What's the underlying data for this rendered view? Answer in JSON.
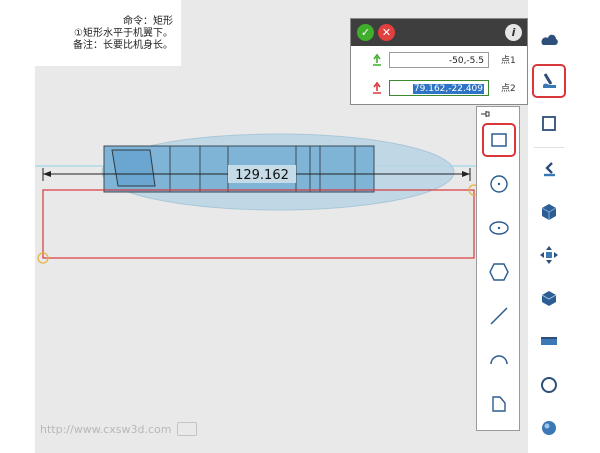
{
  "note": {
    "line1": "命令：矩形",
    "line2": "①矩形水平于机翼下。",
    "line3": "备注：长要比机身长。"
  },
  "dimension": {
    "value": "129.162"
  },
  "watermark": {
    "text": "http://www.cxsw3d.com"
  },
  "dialog": {
    "point1_label": "点1",
    "point1_value": "-50,-5.5",
    "point2_label": "点2",
    "point2_value": "79.162,-22.409"
  },
  "shape_tools": [
    {
      "icon": "rectangle-icon",
      "selected": true
    },
    {
      "icon": "circle-icon",
      "selected": false
    },
    {
      "icon": "ellipse-icon",
      "selected": false
    },
    {
      "icon": "hexagon-icon",
      "selected": false
    },
    {
      "icon": "line-icon",
      "selected": false
    },
    {
      "icon": "arc-icon",
      "selected": false
    },
    {
      "icon": "polyline-icon",
      "selected": false
    }
  ],
  "toolbar_tools": [
    {
      "icon": "cloud-shape-icon",
      "selected": false
    },
    {
      "icon": "sketch-pen-icon",
      "selected": true
    },
    {
      "icon": "square-icon",
      "selected": false
    },
    {
      "icon": "wrench-icon",
      "selected": false
    },
    {
      "icon": "cube-icon",
      "selected": false
    },
    {
      "icon": "move-arrows-icon",
      "selected": false
    },
    {
      "icon": "box-edit-icon",
      "selected": false
    },
    {
      "icon": "panel-icon",
      "selected": false
    },
    {
      "icon": "circle-outline-icon",
      "selected": false
    },
    {
      "icon": "sphere-icon",
      "selected": false
    }
  ],
  "colors": {
    "accent_red": "#d9373a",
    "ok_green": "#3fae2a",
    "cancel_red": "#e0403e",
    "highlight_blue": "#2e74c6"
  }
}
